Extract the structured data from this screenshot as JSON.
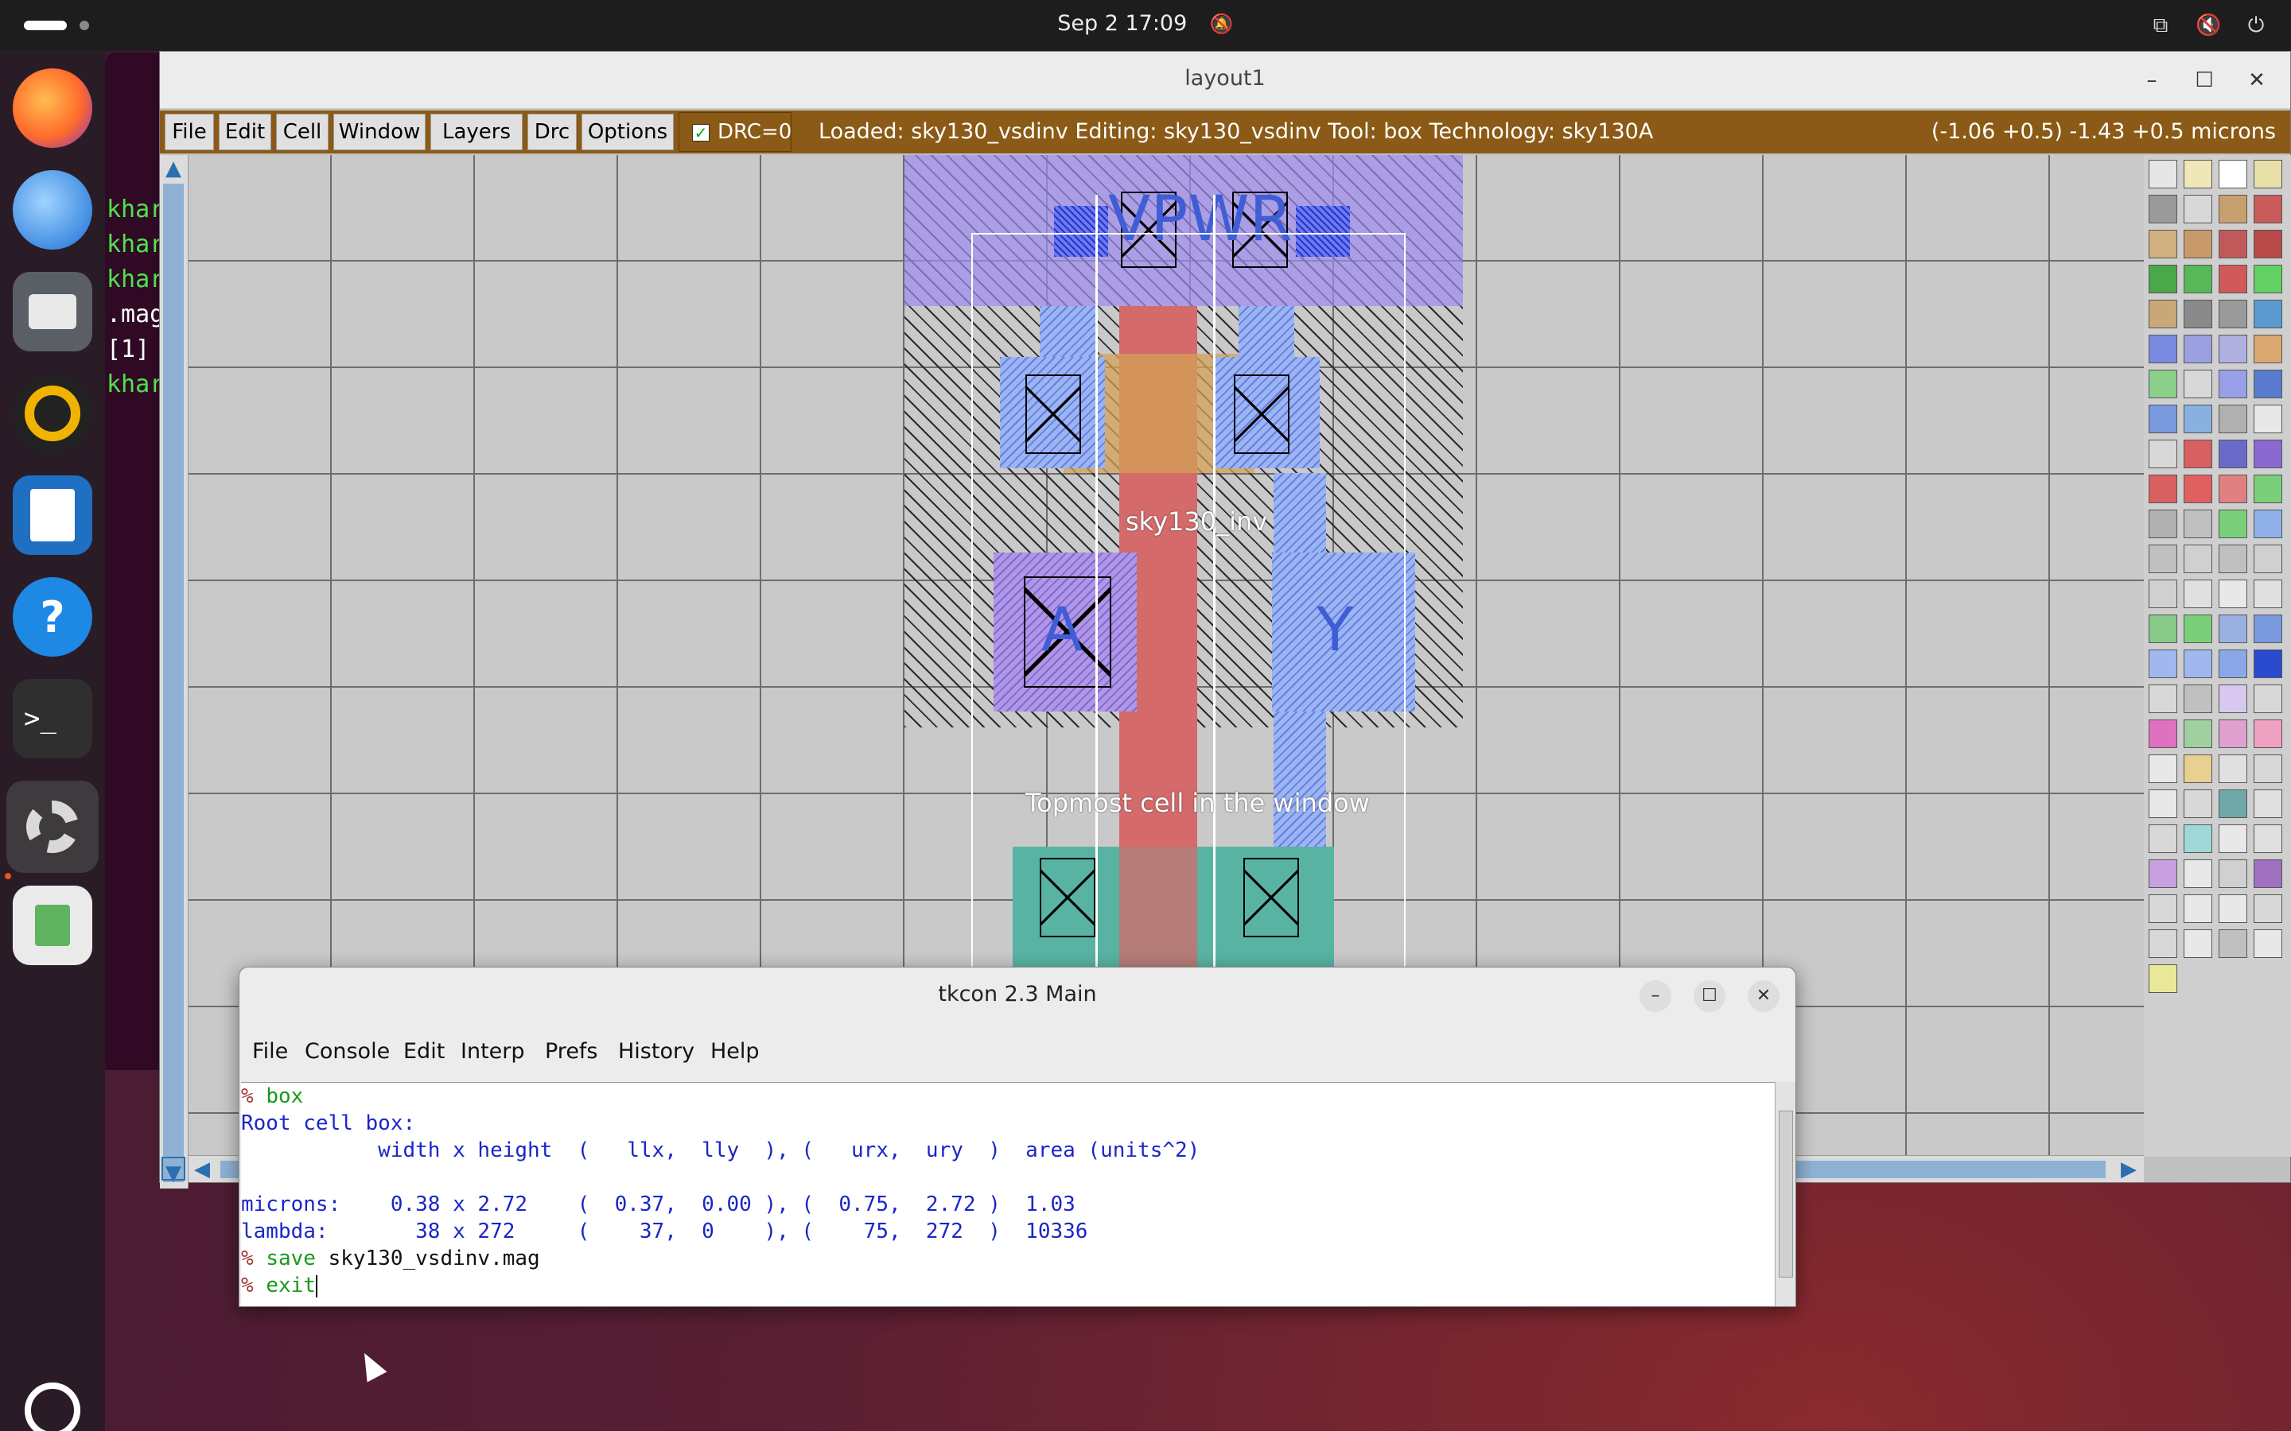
{
  "topbar": {
    "datetime": "Sep 2  17:09",
    "bell": "🔕",
    "network": "⧉",
    "volume": "🔇",
    "power": "⏻"
  },
  "dock": {
    "items": [
      "firefox",
      "thunderbird",
      "files",
      "rhythmbox",
      "libreoffice-writer",
      "help",
      "terminal",
      "settings",
      "trash"
    ],
    "show_apps": "show-apps"
  },
  "terminal_bg": {
    "lines": [
      "khar",
      "khar",
      "khar",
      ".mag",
      "[1]",
      "khar"
    ]
  },
  "layout_window": {
    "title": "layout1",
    "menu": [
      "File",
      "Edit",
      "Cell",
      "Window",
      "Layers",
      "Drc",
      "Options"
    ],
    "drc_label": "DRC=0",
    "status": "Loaded: sky130_vsdinv  Editing: sky130_vsdinv  Tool: box   Technology: sky130A",
    "coords": "(-1.06 +0.5) -1.43 +0.5 microns",
    "labels": {
      "vpwr": "VPWR",
      "cell": "sky130_inv",
      "a": "A",
      "y": "Y",
      "topmost": "Topmost cell in the window"
    }
  },
  "tkcon": {
    "title": "tkcon 2.3 Main",
    "menu": [
      "File",
      "Console",
      "Edit",
      "Interp",
      "Prefs",
      "History",
      "Help"
    ],
    "lines": [
      {
        "prompt": "% ",
        "cmd": "box"
      },
      {
        "out": "Root cell box:"
      },
      {
        "out": "           width x height  (   llx,  lly  ), (   urx,  ury  )  area (units^2)"
      },
      {
        "out": ""
      },
      {
        "out": "microns:    0.38 x 2.72    (  0.37,  0.00 ), (  0.75,  2.72 )  1.03"
      },
      {
        "out": "lambda:       38 x 272     (    37,  0    ), (    75,  272  )  10336"
      },
      {
        "prompt": "% ",
        "cmd": "save",
        "arg": " sky130_vsdinv.mag"
      },
      {
        "prompt": "% ",
        "cmd": "exit"
      }
    ]
  },
  "colors": {
    "accent": "#e95420",
    "menubar": "#8a5a16",
    "console_out": "#1a26c8",
    "console_cmd": "#1a9a1a"
  }
}
